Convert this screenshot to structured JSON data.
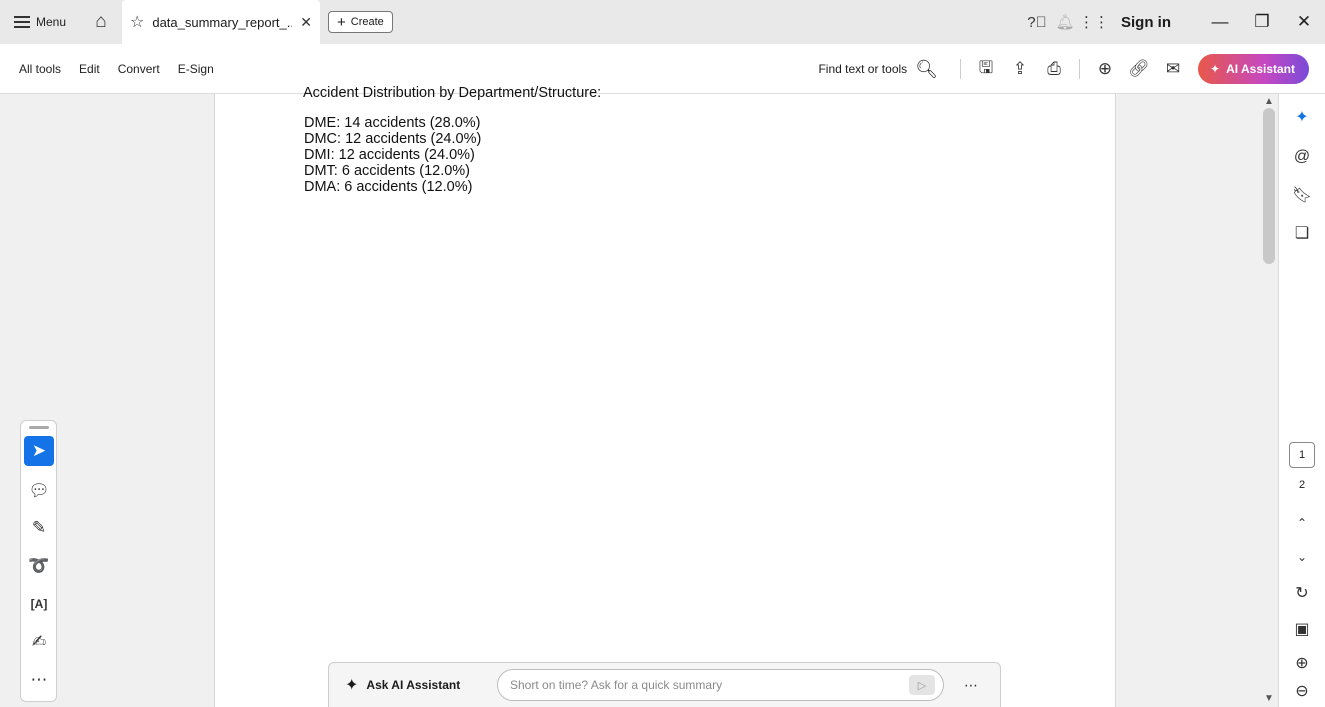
{
  "titlebar": {
    "menu_label": "Menu",
    "tab_title": "data_summary_report_...",
    "create_label": "Create",
    "signin_label": "Sign in"
  },
  "toolbar": {
    "items": [
      "All tools",
      "Edit",
      "Convert",
      "E-Sign"
    ],
    "find_label": "Find text or tools",
    "ai_assistant_label": "AI Assistant"
  },
  "document": {
    "heading": "Accident Distribution by Department/Structure:",
    "departments": [
      "DME: 14 accidents (28.0%)",
      "DMC: 12 accidents (24.0%)",
      "DMI: 12 accidents (24.0%)",
      "DMT: 6 accidents (12.0%)",
      "DMA: 6 accidents (12.0%)"
    ]
  },
  "page_nav": {
    "current_page": "1",
    "total_pages": "2"
  },
  "ask_bar": {
    "label": "Ask AI Assistant",
    "placeholder": "Short on time? Ask for a quick summary"
  },
  "colors": {
    "accent": "#1473e6",
    "ai_gradient_start": "#e8584a",
    "ai_gradient_end": "#7a4bd8"
  }
}
